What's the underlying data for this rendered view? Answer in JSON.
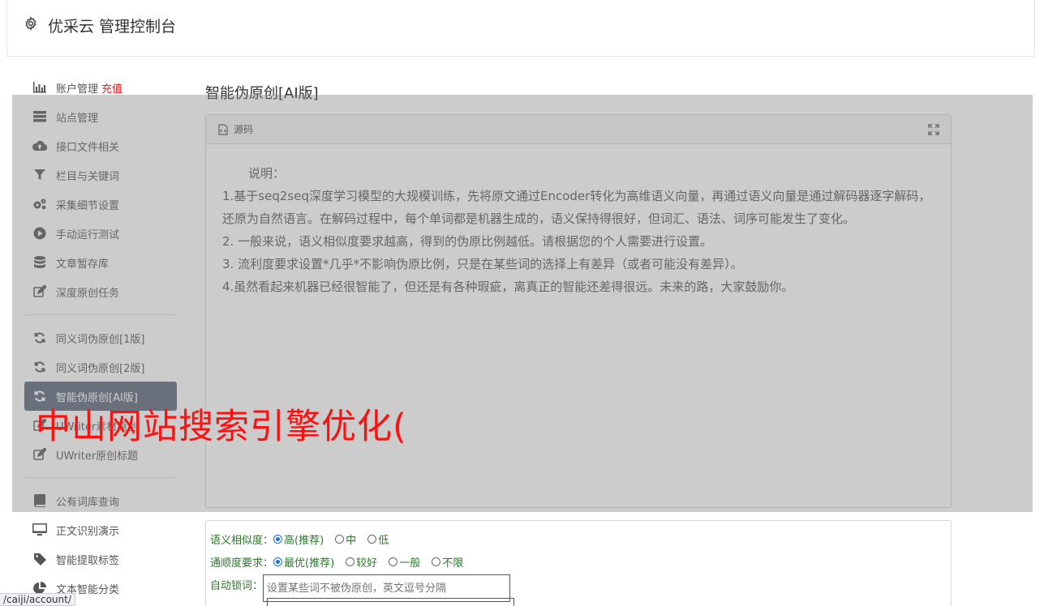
{
  "header": {
    "title": "优采云 管理控制台"
  },
  "sidebar": {
    "groups": [
      [
        {
          "label": "账户管理",
          "badge": "充值",
          "icon": "bar-chart-icon"
        },
        {
          "label": "站点管理",
          "icon": "server-icon"
        },
        {
          "label": "接口文件相关",
          "icon": "cloud-upload-icon"
        },
        {
          "label": "栏目与关键词",
          "icon": "filter-icon"
        },
        {
          "label": "采集细节设置",
          "icon": "gears-icon"
        },
        {
          "label": "手动运行测试",
          "icon": "play-circle-icon"
        },
        {
          "label": "文章暂存库",
          "icon": "database-icon"
        },
        {
          "label": "深度原创任务",
          "icon": "edit-icon"
        }
      ],
      [
        {
          "label": "同义词伪原创[1版]",
          "icon": "refresh-icon"
        },
        {
          "label": "同义词伪原创[2版]",
          "icon": "refresh-icon"
        },
        {
          "label": "智能伪原创[AI版]",
          "icon": "refresh-icon",
          "active": true
        },
        {
          "label": "UWriter素材原创",
          "icon": "edit-icon"
        },
        {
          "label": "UWriter原创标题",
          "icon": "edit-icon"
        }
      ],
      [
        {
          "label": "公有词库查询",
          "icon": "book-icon"
        },
        {
          "label": "正文识别演示",
          "icon": "monitor-icon"
        },
        {
          "label": "智能提取标签",
          "icon": "tag-icon"
        },
        {
          "label": "文本智能分类",
          "icon": "pie-chart-icon"
        }
      ]
    ]
  },
  "main": {
    "title": "智能伪原创[AI版]",
    "panel": {
      "header": "源码",
      "intro": "说明：",
      "lines": [
        "1.基于seq2seq深度学习模型的大规模训练，先将原文通过Encoder转化为高维语义向量，再通过语义向量是通过解码器逐字解码，还原为自然语言。在解码过程中，每个单词都是机器生成的，语义保持得很好，但词汇、语法、词序可能发生了变化。",
        "2. 一般来说，语义相似度要求越高，得到的伪原比例越低。请根据您的个人需要进行设置。",
        "3. 流利度要求设置*几乎*不影响伪原比例，只是在某些词的选择上有差异（或者可能没有差异）。",
        "4.虽然看起来机器已经很智能了，但还是有各种瑕疵，离真正的智能还差得很远。未来的路，大家鼓励你。"
      ]
    },
    "options": {
      "similarity": {
        "label": "语义相似度：",
        "choices": [
          "高(推荐)",
          "中",
          "低"
        ],
        "selected": 0
      },
      "fluency": {
        "label": "通顺度要求：",
        "choices": [
          "最优(推荐)",
          "较好",
          "一般",
          "不限"
        ],
        "selected": 0
      },
      "lock": {
        "label": "自动锁词：",
        "placeholder": "设置某些词不被伪原创，英文逗号分隔"
      }
    }
  },
  "watermark": "中山网站搜索引擎优化(",
  "statusbar": {
    "url": "/caiji/account/"
  }
}
